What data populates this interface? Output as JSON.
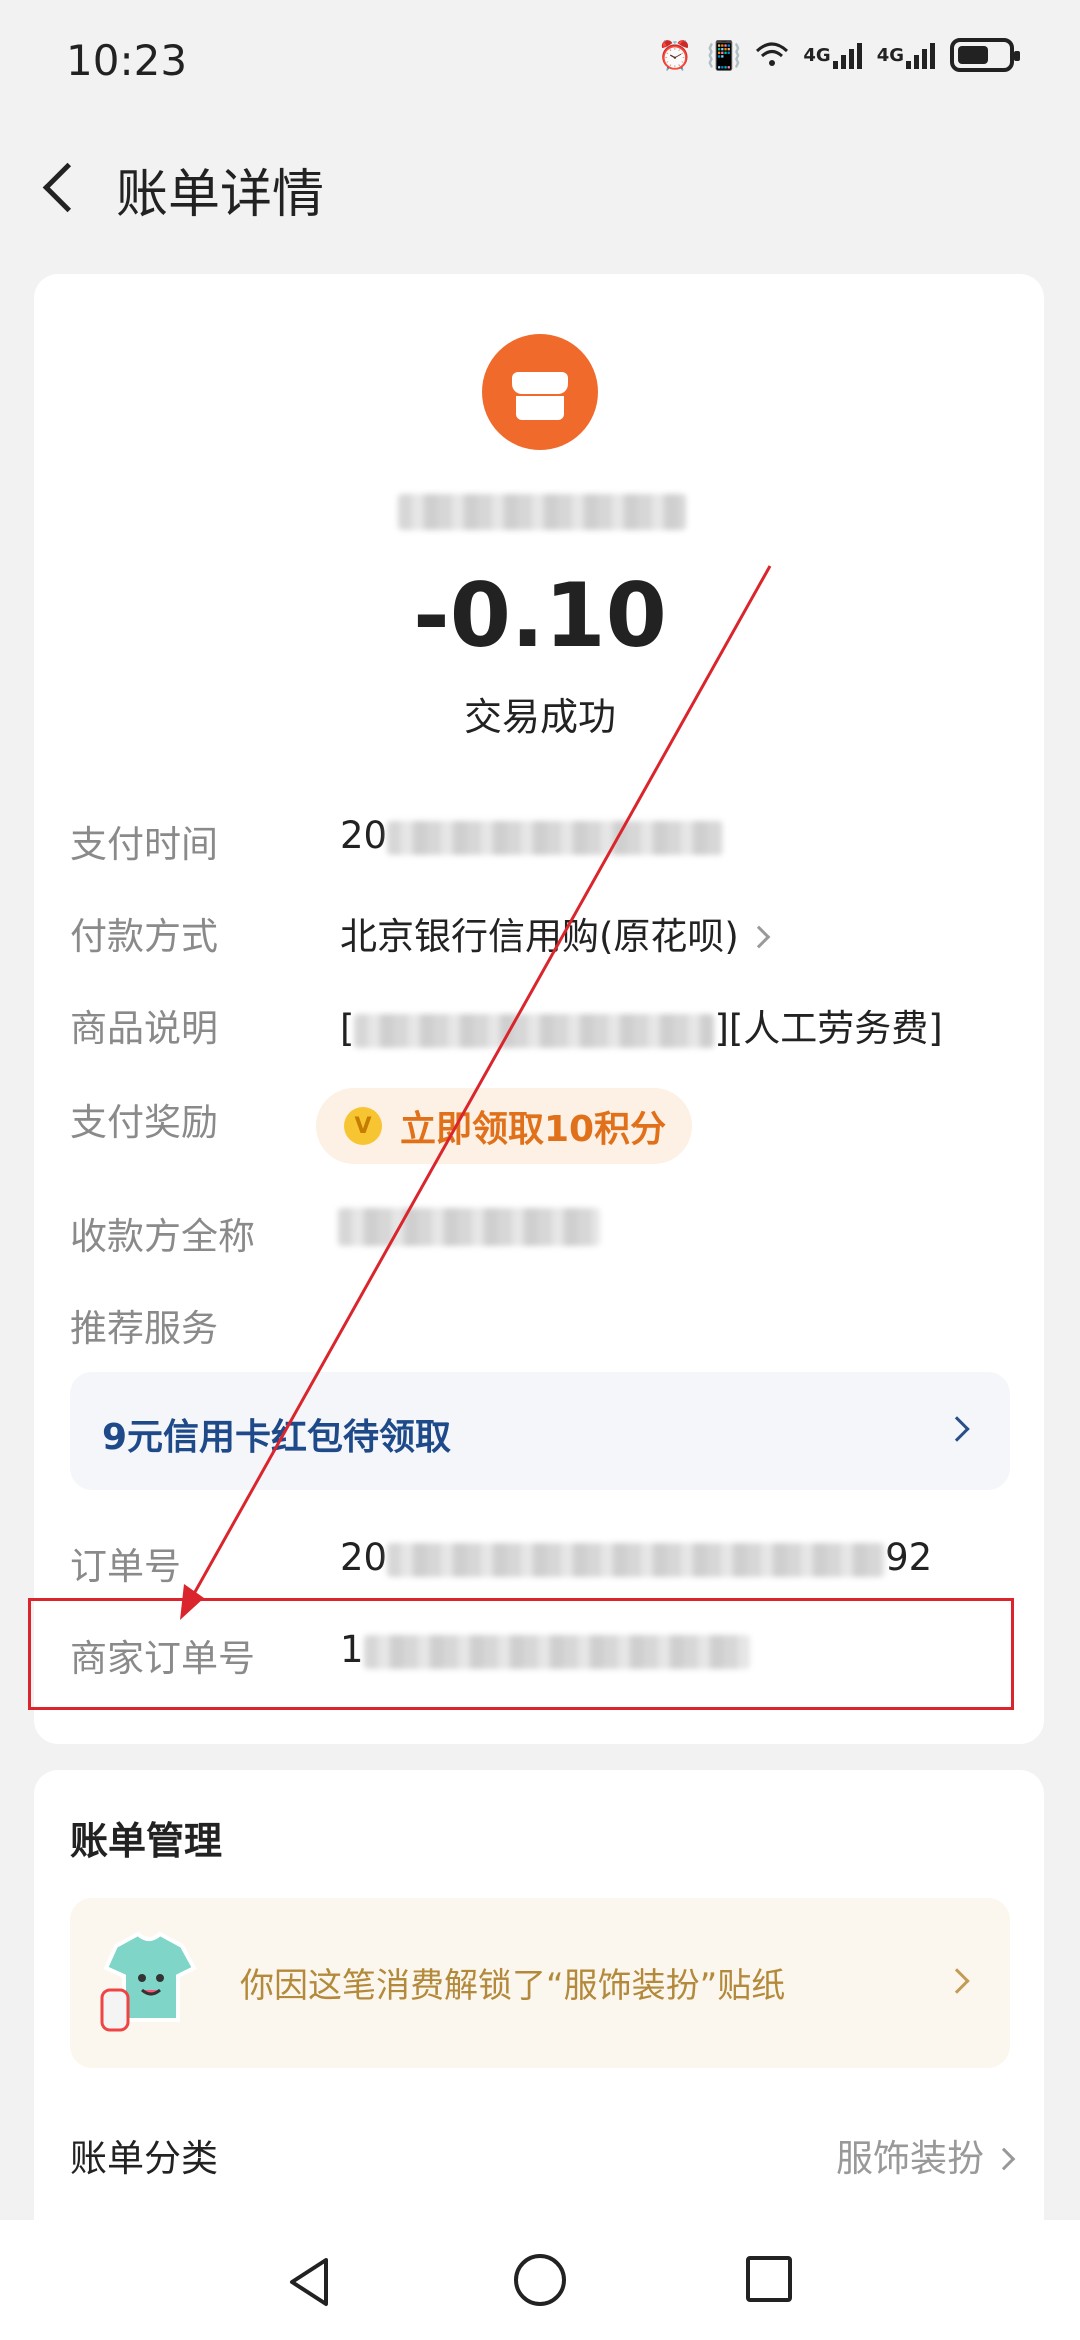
{
  "status_bar": {
    "time": "10:23",
    "signal1_label": "4G",
    "signal2_label": "4G"
  },
  "header": {
    "title": "账单详情"
  },
  "transaction": {
    "amount": "-0.10",
    "status": "交易成功"
  },
  "details": {
    "pay_time_label": "支付时间",
    "pay_time_value_prefix": "20",
    "pay_method_label": "付款方式",
    "pay_method_value": "北京银行信用购(原花呗)",
    "product_label": "商品说明",
    "product_value_open": "[",
    "product_value_suffix": "][人工劳务费]",
    "reward_label": "支付奖励",
    "reward_button": "立即领取10积分",
    "reward_coin": "V",
    "payee_label": "收款方全称",
    "recommend_label": "推荐服务",
    "promo_text": "9元信用卡红包待领取",
    "order_label": "订单号",
    "order_prefix": "20",
    "order_suffix": "92",
    "merchant_order_label": "商家订单号",
    "merchant_order_prefix": "1"
  },
  "bill_management": {
    "title": "账单管理",
    "sticker_text": "你因这笔消费解锁了“服饰装扮”贴纸",
    "category_label": "账单分类",
    "category_value": "服饰装扮"
  },
  "colors": {
    "accent_orange": "#f06a2b",
    "highlight_red": "#d9252b",
    "promo_blue": "#1f4a8a"
  }
}
